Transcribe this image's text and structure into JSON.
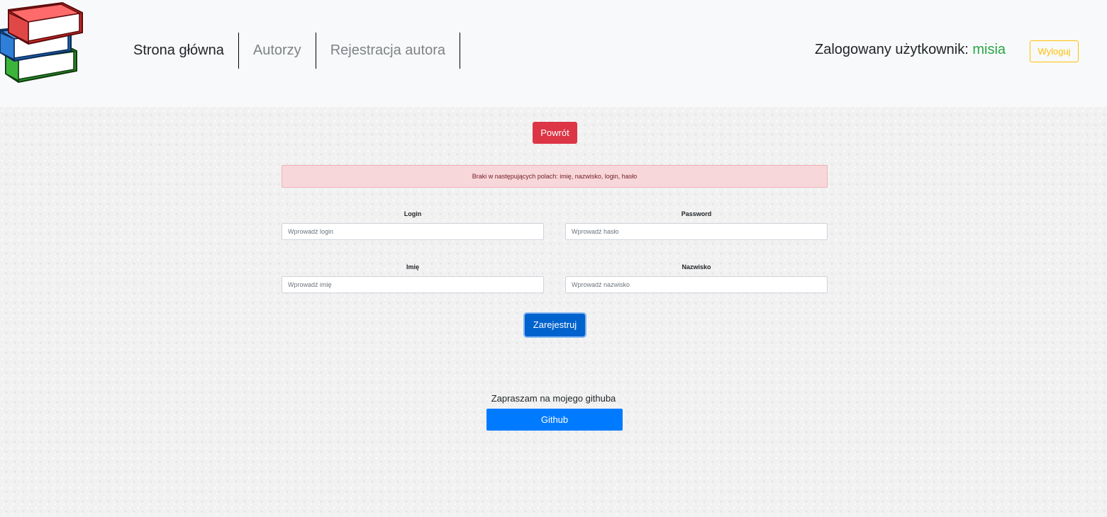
{
  "nav": {
    "links": [
      {
        "label": "Strona główna",
        "active": true
      },
      {
        "label": "Autorzy",
        "active": false
      },
      {
        "label": "Rejestracja autora",
        "active": false
      }
    ],
    "user_prefix": "Zalogowany użytkownik:",
    "user_name": "misia",
    "logout_label": "Wyloguj"
  },
  "main": {
    "back_label": "Powrót",
    "alert_text": "Braki w następujących polach: imię, nazwisko, login, hasło",
    "fields": {
      "login": {
        "label": "Login",
        "placeholder": "Wprowadź login",
        "value": ""
      },
      "password": {
        "label": "Password",
        "placeholder": "Wprowadź hasło",
        "value": ""
      },
      "first_name": {
        "label": "Imię",
        "placeholder": "Wprowadź imię",
        "value": ""
      },
      "last_name": {
        "label": "Nazwisko",
        "placeholder": "Wprowadź nazwisko",
        "value": ""
      }
    },
    "submit_label": "Zarejestruj"
  },
  "footer": {
    "text": "Zapraszam na mojego githuba",
    "github_label": "Github"
  },
  "colors": {
    "danger": "#dc3545",
    "primary": "#007bff",
    "warning": "#ffc107",
    "success": "#28a745",
    "alert_bg": "#f8d7da"
  },
  "icons": {
    "logo": "books-stack-icon"
  }
}
